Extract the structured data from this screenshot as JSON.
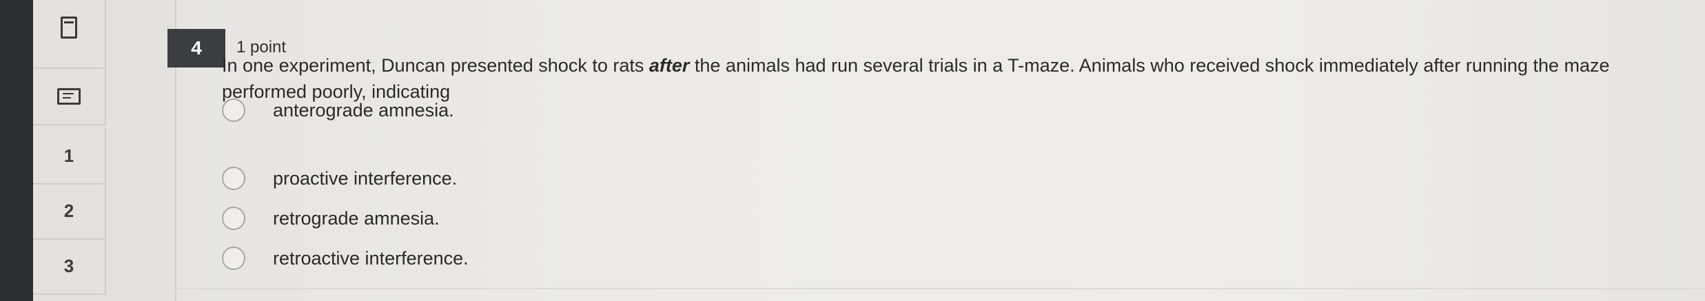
{
  "sidebar": {
    "items": [
      {
        "type": "icon",
        "icon": "bookmark-icon",
        "label": ""
      },
      {
        "type": "icon",
        "icon": "note-icon",
        "label": ""
      },
      {
        "type": "number",
        "label": "1"
      },
      {
        "type": "number",
        "label": "2"
      },
      {
        "type": "number",
        "label": "3"
      }
    ]
  },
  "question": {
    "number": "4",
    "points": "1 point",
    "text_before": "In one experiment, Duncan presented shock to rats ",
    "text_emphasis": "after",
    "text_after": " the animals had run several trials in a T-maze. Animals who received shock immediately after running the maze performed poorly, indicating",
    "options": [
      {
        "label": "anterograde amnesia.",
        "selected": false
      },
      {
        "label": "proactive interference.",
        "selected": false
      },
      {
        "label": "retrograde amnesia.",
        "selected": false
      },
      {
        "label": "retroactive interference.",
        "selected": false
      }
    ]
  },
  "colors": {
    "question_badge": "#3b3d41",
    "dark_edge": "#2b2d31",
    "background": "#ecebe8"
  }
}
